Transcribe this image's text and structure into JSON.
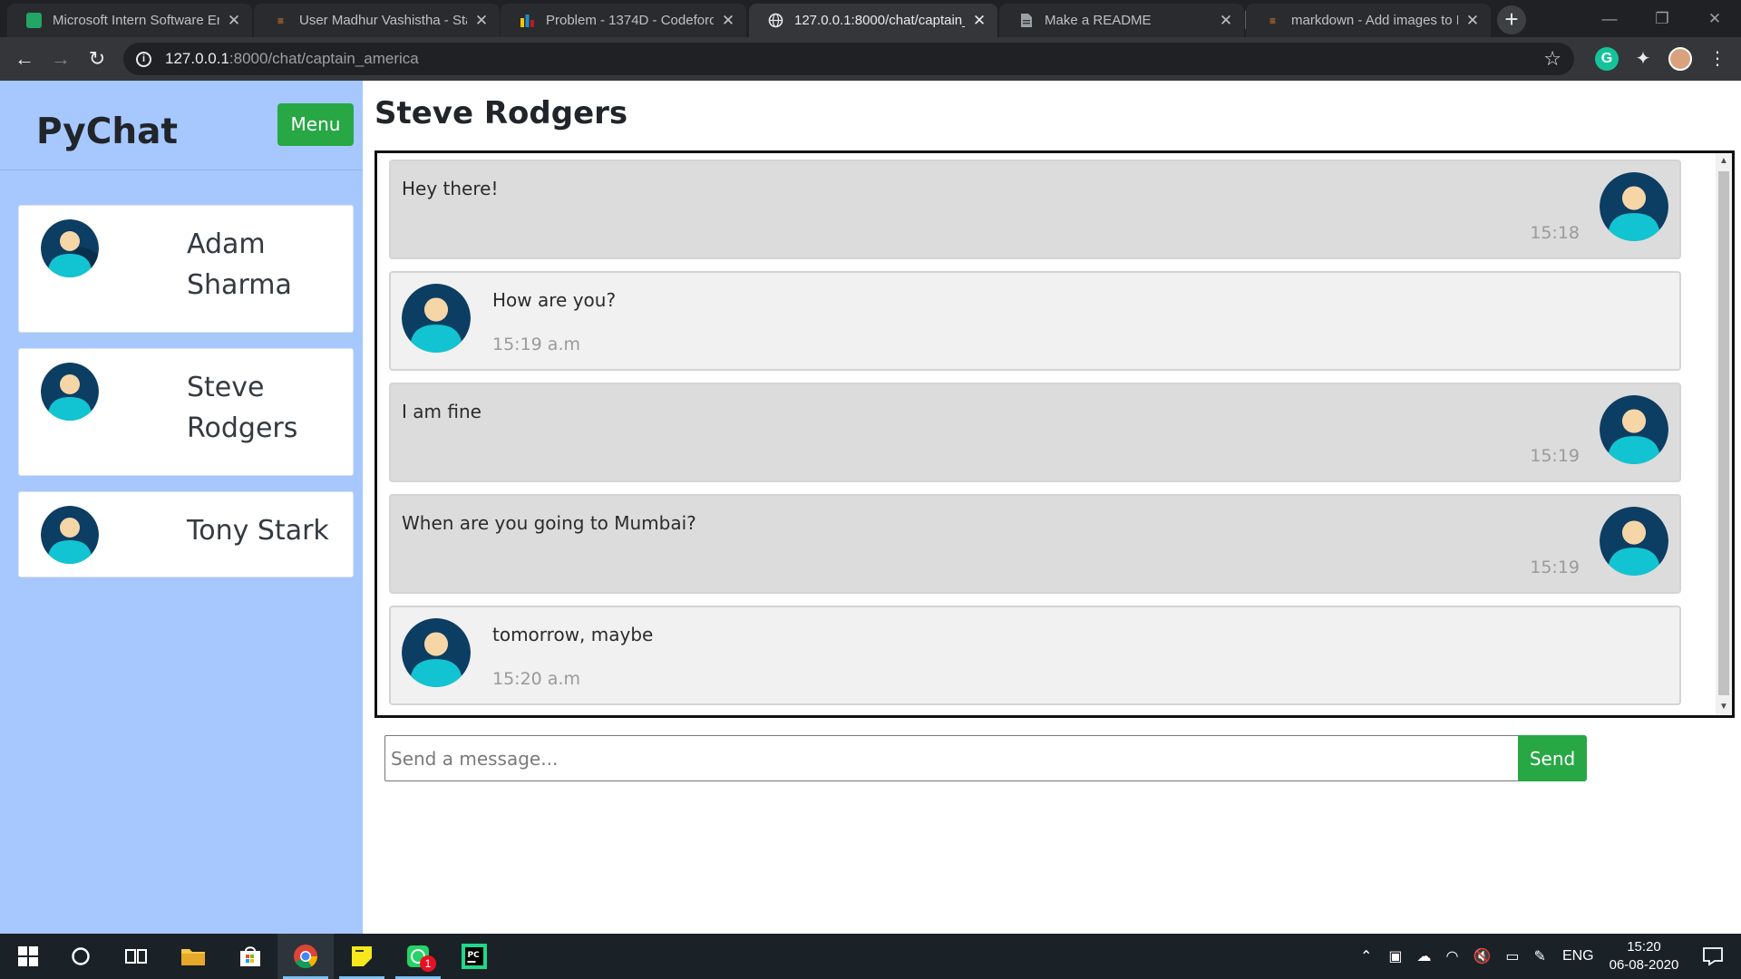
{
  "browser": {
    "tabs": [
      {
        "label": "Microsoft Intern Software En",
        "icon": "sheets-icon",
        "favicon_color": "#23a566",
        "active": false
      },
      {
        "label": "User Madhur Vashistha - Stac",
        "icon": "stackoverflow-icon",
        "favicon_color": "#f48024",
        "active": false
      },
      {
        "label": "Problem - 1374D - Codeforc",
        "icon": "codeforces-icon",
        "favicon_color": "#1f8acb",
        "active": false
      },
      {
        "label": "127.0.0.1:8000/chat/captain_",
        "icon": "globe-icon",
        "favicon_color": "#e8eaed",
        "active": true
      },
      {
        "label": "Make a README",
        "icon": "document-icon",
        "favicon_color": "#9aa0a6",
        "active": false
      },
      {
        "label": "markdown - Add images to R",
        "icon": "stackoverflow-icon",
        "favicon_color": "#f48024",
        "active": false
      }
    ],
    "url_host": "127.0.0.1",
    "url_rest": ":8000/chat/captain_america"
  },
  "app": {
    "brand": "PyChat",
    "menu_label": "Menu",
    "contacts": [
      {
        "name": "Adam Sharma"
      },
      {
        "name": "Steve Rodgers"
      },
      {
        "name": "Tony Stark"
      }
    ],
    "chat_title": "Steve Rodgers",
    "messages": [
      {
        "text": "Hey there!",
        "time": "15:18",
        "side": "sent"
      },
      {
        "text": "How are you?",
        "time": "15:19 a.m",
        "side": "received"
      },
      {
        "text": "I am fine",
        "time": "15:19",
        "side": "sent"
      },
      {
        "text": "When are you going to Mumbai?",
        "time": "15:19",
        "side": "sent"
      },
      {
        "text": "tomorrow, maybe",
        "time": "15:20 a.m",
        "side": "received"
      }
    ],
    "composer": {
      "placeholder": "Send a message...",
      "send_label": "Send"
    }
  },
  "colors": {
    "sidebar_bg": "#a6c8ff",
    "button_green": "#28a745",
    "sent_bubble": "#dcdcdc",
    "received_bubble": "#f1f1f1",
    "avatar_bg": "#0c3d63",
    "avatar_body": "#12c4d1",
    "avatar_face": "#f6d5a7"
  },
  "taskbar": {
    "apps": [
      "windows-start-icon",
      "cortana-circle-icon",
      "task-view-icon",
      "file-explorer-icon",
      "store-icon",
      "chrome-icon",
      "sticky-notes-icon",
      "whatsapp-icon",
      "pycharm-icon"
    ],
    "whatsapp_badge": "1",
    "language": "ENG",
    "time": "15:20",
    "date": "06-08-2020"
  }
}
